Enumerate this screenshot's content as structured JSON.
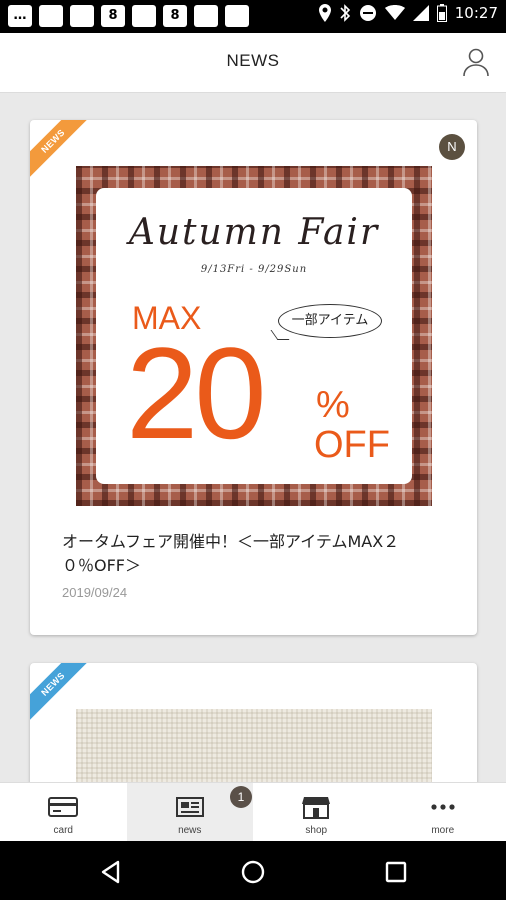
{
  "status_bar": {
    "time": "10:27",
    "notification_icons": [
      "chat-icon",
      "app-icon",
      "app-icon",
      "app-icon-8",
      "app-icon",
      "app-icon-8",
      "app-icon",
      "app-icon"
    ],
    "system_icons": [
      "location-icon",
      "bluetooth-icon",
      "dnd-icon",
      "wifi-icon",
      "signal-icon",
      "battery-icon"
    ]
  },
  "header": {
    "title": "NEWS",
    "account_icon": "user-icon"
  },
  "news": [
    {
      "ribbon": "NEWS",
      "ribbon_color": "#f39a3c",
      "badge": "N",
      "banner": {
        "title": "Autumn Fair",
        "dates": "9/13Fri - 9/29Sun",
        "max": "MAX",
        "bubble": "一部アイテム",
        "number": "20",
        "percent": "%",
        "off": "OFF"
      },
      "title": "オータムフェア開催中！＜一部アイテムMAX２０％OFF＞",
      "date": "2019/09/24"
    },
    {
      "ribbon": "NEWS",
      "ribbon_color": "#45a2d9"
    }
  ],
  "bottom_nav": {
    "items": [
      {
        "label": "card",
        "icon": "card-icon"
      },
      {
        "label": "news",
        "icon": "news-icon"
      },
      {
        "label": "shop",
        "icon": "shop-icon"
      },
      {
        "label": "more",
        "icon": "more-icon"
      }
    ],
    "news_badge": "1",
    "active": "news"
  },
  "system_nav": [
    "back-icon",
    "home-icon",
    "recents-icon"
  ],
  "colors": {
    "accent_orange": "#ea5a1a",
    "ribbon_orange": "#f39a3c",
    "ribbon_blue": "#45a2d9",
    "badge_brown": "#5a5048"
  }
}
